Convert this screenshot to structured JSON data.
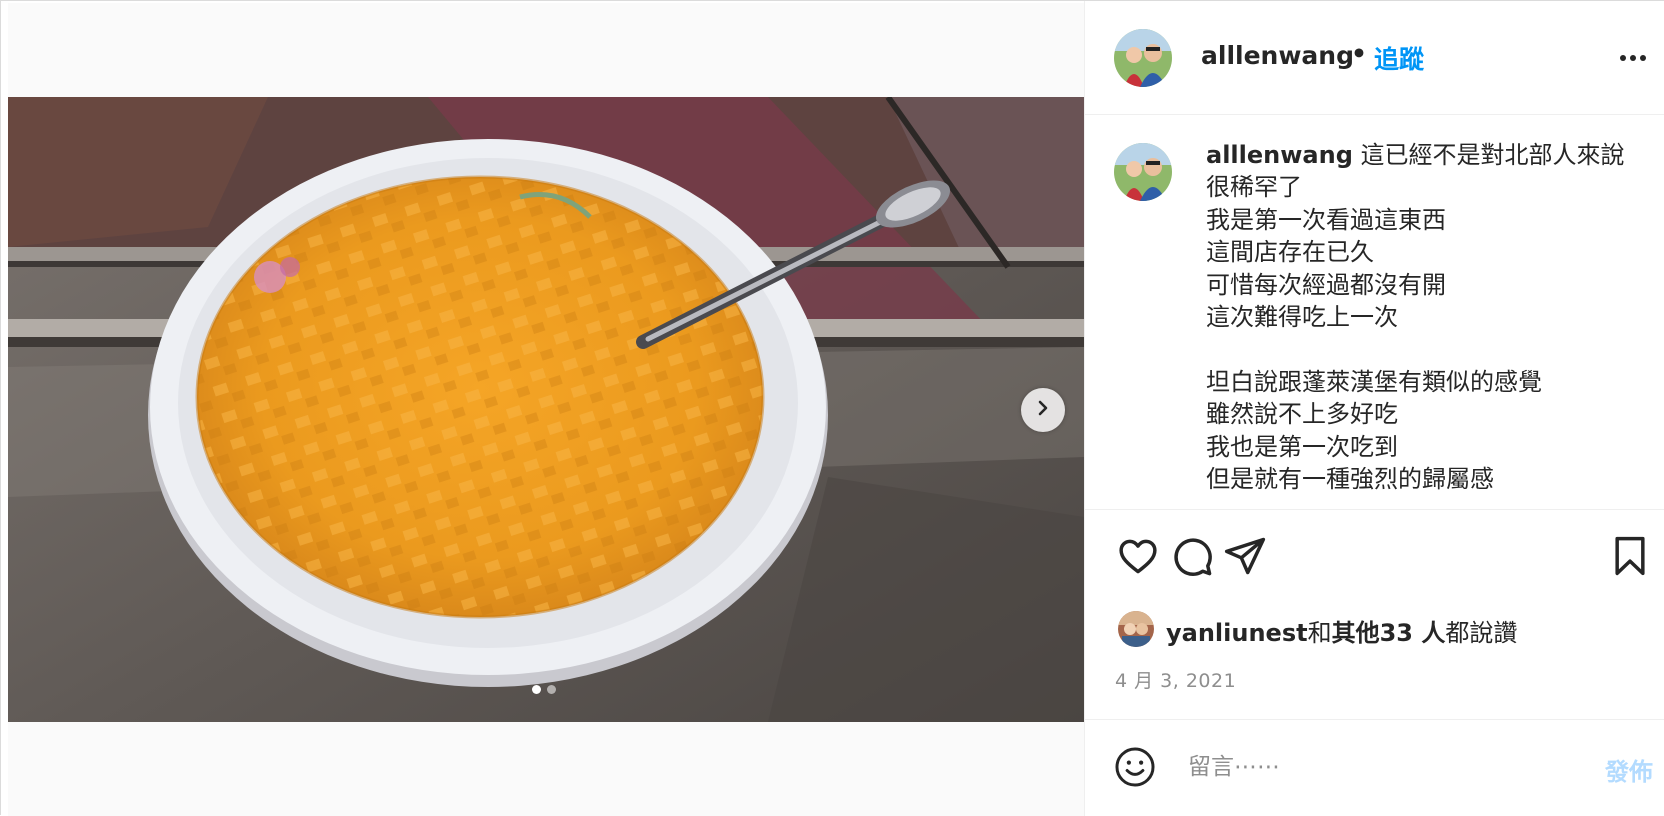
{
  "post": {
    "username": "alllenwang",
    "separator": "•",
    "follow_label": "追蹤",
    "more_icon": "more-horizontal-icon",
    "caption_user": "alllenwang",
    "caption_text": " 這已經不是對北部人來說很稀罕了\n我是第一次看過這東西\n這間店存在已久\n可惜每次經過都沒有開\n這次難得吃上一次\n\n坦白說跟蓬萊漢堡有類似的感覺\n雖然說不上多好吃\n我也是第一次吃到\n但是就有一種強烈的歸屬感",
    "likes_user": "yanliunest",
    "likes_and": "和",
    "likes_others": "其他33 人",
    "likes_suffix": "都說讚",
    "date": "4 月 3, 2021",
    "comment_placeholder": "留言⋯⋯",
    "post_label": "發佈",
    "carousel": {
      "count": 2,
      "active": 0
    }
  },
  "icons": {
    "like": "heart-icon",
    "comment": "comment-bubble-icon",
    "share": "paper-plane-icon",
    "save": "bookmark-icon",
    "emoji": "smiley-icon",
    "next": "chevron-right-icon"
  },
  "colors": {
    "accent": "#0095f6",
    "post_disabled": "#b3dbff",
    "muted": "#8e8e8e",
    "text": "#262626"
  }
}
